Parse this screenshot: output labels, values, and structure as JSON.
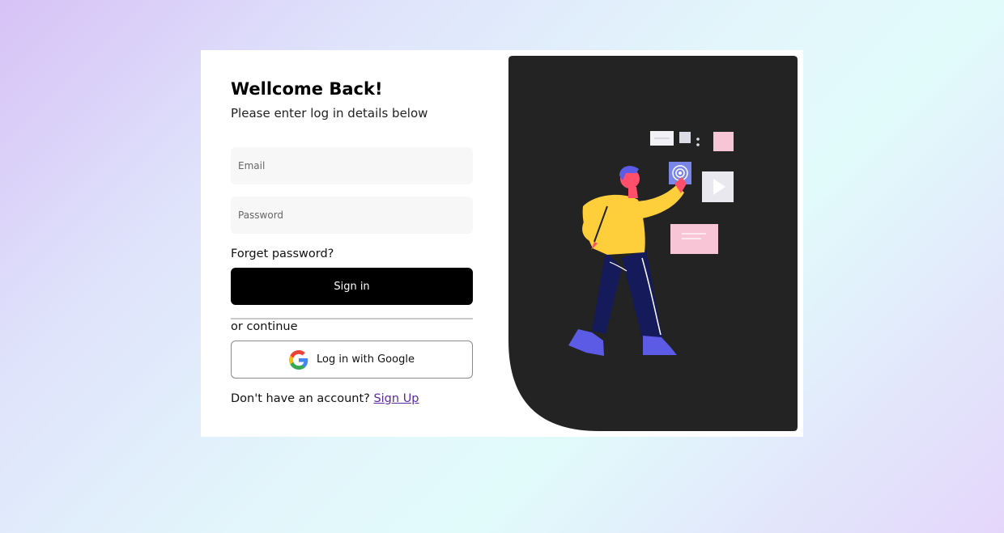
{
  "login": {
    "title": "Wellcome Back!",
    "subtitle": "Please enter log in details below",
    "email_placeholder": "Email",
    "password_placeholder": "Password",
    "forget_label": "Forget password?",
    "signin_label": "Sign in",
    "divider_text": "or continue",
    "google_label": "Log in with Google",
    "signup_prompt": "Don't have an account?",
    "signup_link": "Sign Up"
  },
  "icons": {
    "google": "google-g-icon",
    "illustration": "person-touching-screen-illustration"
  },
  "colors": {
    "button_bg": "#000000",
    "panel_bg": "#232323",
    "link": "#5b2aa0",
    "field_bg": "#f7f7f7"
  }
}
